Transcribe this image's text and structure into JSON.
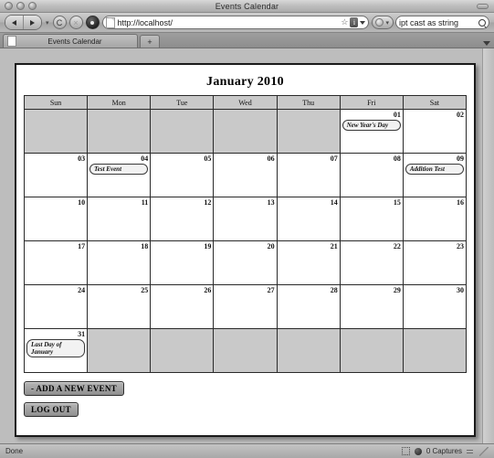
{
  "browser": {
    "window_title": "Events Calendar",
    "url": "http://localhost/",
    "search_query": "ipt cast as string",
    "tab_label": "Events Calendar",
    "new_tab_label": "+",
    "back_label": "Back",
    "forward_label": "Forward",
    "reload_label": "C",
    "stop_label": "×",
    "info_label": "i",
    "status_left": "Done",
    "status_captures": "0 Captures"
  },
  "page": {
    "title": "January 2010",
    "weekday_headers": [
      "Sun",
      "Mon",
      "Tue",
      "Wed",
      "Thu",
      "Fri",
      "Sat"
    ],
    "weeks": [
      [
        {
          "day": "",
          "blank": true,
          "events": []
        },
        {
          "day": "",
          "blank": true,
          "events": []
        },
        {
          "day": "",
          "blank": true,
          "events": []
        },
        {
          "day": "",
          "blank": true,
          "events": []
        },
        {
          "day": "",
          "blank": true,
          "events": []
        },
        {
          "day": "01",
          "blank": false,
          "events": [
            "New Year's Day"
          ]
        },
        {
          "day": "02",
          "blank": false,
          "events": []
        }
      ],
      [
        {
          "day": "03",
          "blank": false,
          "events": []
        },
        {
          "day": "04",
          "blank": false,
          "events": [
            "Test Event"
          ]
        },
        {
          "day": "05",
          "blank": false,
          "events": []
        },
        {
          "day": "06",
          "blank": false,
          "events": []
        },
        {
          "day": "07",
          "blank": false,
          "events": []
        },
        {
          "day": "08",
          "blank": false,
          "events": []
        },
        {
          "day": "09",
          "blank": false,
          "events": [
            "Addition Test"
          ]
        }
      ],
      [
        {
          "day": "10",
          "blank": false,
          "events": []
        },
        {
          "day": "11",
          "blank": false,
          "events": []
        },
        {
          "day": "12",
          "blank": false,
          "events": []
        },
        {
          "day": "13",
          "blank": false,
          "events": []
        },
        {
          "day": "14",
          "blank": false,
          "events": []
        },
        {
          "day": "15",
          "blank": false,
          "events": []
        },
        {
          "day": "16",
          "blank": false,
          "events": []
        }
      ],
      [
        {
          "day": "17",
          "blank": false,
          "events": []
        },
        {
          "day": "18",
          "blank": false,
          "events": []
        },
        {
          "day": "19",
          "blank": false,
          "events": []
        },
        {
          "day": "20",
          "blank": false,
          "events": []
        },
        {
          "day": "21",
          "blank": false,
          "events": []
        },
        {
          "day": "22",
          "blank": false,
          "events": []
        },
        {
          "day": "23",
          "blank": false,
          "events": []
        }
      ],
      [
        {
          "day": "24",
          "blank": false,
          "events": []
        },
        {
          "day": "25",
          "blank": false,
          "events": []
        },
        {
          "day": "26",
          "blank": false,
          "events": []
        },
        {
          "day": "27",
          "blank": false,
          "events": []
        },
        {
          "day": "28",
          "blank": false,
          "events": []
        },
        {
          "day": "29",
          "blank": false,
          "events": []
        },
        {
          "day": "30",
          "blank": false,
          "events": []
        }
      ],
      [
        {
          "day": "31",
          "blank": false,
          "events": [
            "Last Day of January"
          ]
        },
        {
          "day": "",
          "blank": true,
          "events": []
        },
        {
          "day": "",
          "blank": true,
          "events": []
        },
        {
          "day": "",
          "blank": true,
          "events": []
        },
        {
          "day": "",
          "blank": true,
          "events": []
        },
        {
          "day": "",
          "blank": true,
          "events": []
        },
        {
          "day": "",
          "blank": true,
          "events": []
        }
      ]
    ],
    "add_event_button": "- ADD A NEW EVENT",
    "logout_button": "LOG OUT"
  },
  "colors": {
    "blank_cell": "#c9c9c9",
    "header_cell": "#c9c9c9",
    "page_bg": "#ffffff",
    "chrome_bg": "#bdbdbd",
    "border": "#2a2a2a"
  }
}
